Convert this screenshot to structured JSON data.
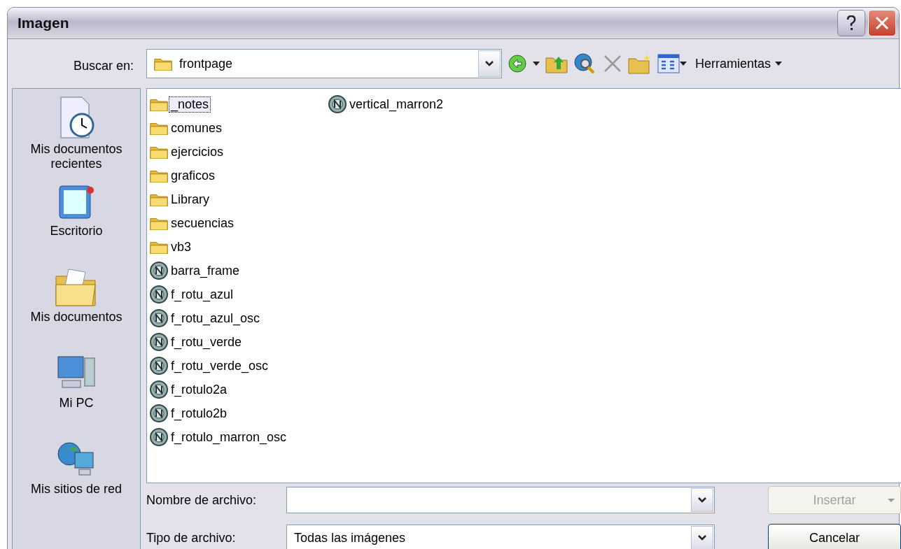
{
  "window": {
    "title": "Imagen"
  },
  "look_in": {
    "label": "Buscar en:",
    "value": "frontpage"
  },
  "toolbar": {
    "menu": "Herramientas"
  },
  "places": [
    {
      "label": "Mis documentos recientes",
      "kind": "recent"
    },
    {
      "label": "Escritorio",
      "kind": "desktop"
    },
    {
      "label": "Mis documentos",
      "kind": "documents"
    },
    {
      "label": "Mi PC",
      "kind": "computer"
    },
    {
      "label": "Mis sitios de red",
      "kind": "network"
    }
  ],
  "files": [
    {
      "name": "_notes",
      "kind": "folder",
      "selected": true
    },
    {
      "name": "comunes",
      "kind": "folder",
      "selected": false
    },
    {
      "name": "ejercicios",
      "kind": "folder",
      "selected": false
    },
    {
      "name": "graficos",
      "kind": "folder",
      "selected": false
    },
    {
      "name": "Library",
      "kind": "folder",
      "selected": false
    },
    {
      "name": "secuencias",
      "kind": "folder",
      "selected": false
    },
    {
      "name": "vb3",
      "kind": "folder",
      "selected": false
    },
    {
      "name": "barra_frame",
      "kind": "image",
      "selected": false
    },
    {
      "name": "f_rotu_azul",
      "kind": "image",
      "selected": false
    },
    {
      "name": "f_rotu_azul_osc",
      "kind": "image",
      "selected": false
    },
    {
      "name": "f_rotu_verde",
      "kind": "image",
      "selected": false
    },
    {
      "name": "f_rotu_verde_osc",
      "kind": "image",
      "selected": false
    },
    {
      "name": "f_rotulo2a",
      "kind": "image",
      "selected": false
    },
    {
      "name": "f_rotulo2b",
      "kind": "image",
      "selected": false
    },
    {
      "name": "f_rotulo_marron_osc",
      "kind": "image",
      "selected": false
    },
    {
      "name": "vertical_marron2",
      "kind": "image",
      "selected": false
    }
  ],
  "file_name": {
    "label": "Nombre de archivo:"
  },
  "file_type": {
    "label": "Tipo de archivo:",
    "value": "Todas las imágenes"
  },
  "buttons": [
    {
      "label": "Insertar",
      "disabled": true,
      "split": true
    },
    {
      "label": "Cancelar",
      "disabled": false,
      "split": false
    }
  ]
}
